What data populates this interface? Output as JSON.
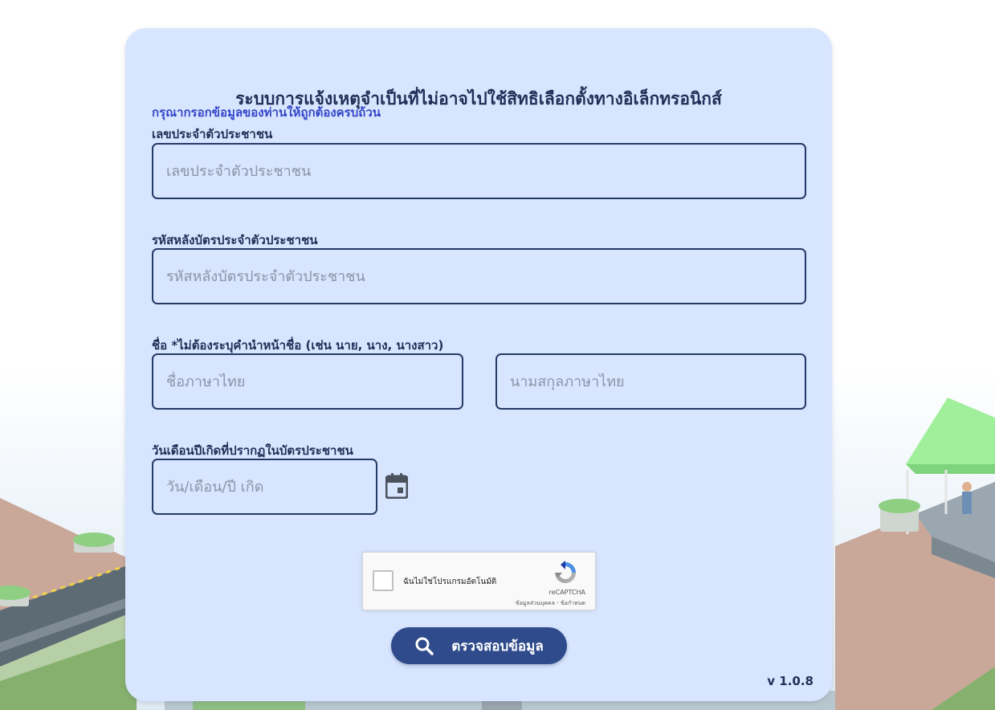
{
  "form": {
    "title": "ระบบการแจ้งเหตุจำเป็นที่ไม่อาจไปใช้สิทธิเลือกตั้งทางอิเล็กทรอนิกส์",
    "hint": "กรุณากรอกข้อมูลของท่านให้ถูกต้องครบถ้วน",
    "citizen_id": {
      "label": "เลขประจำตัวประชาชน",
      "placeholder": "เลขประจำตัวประชาชน",
      "value": ""
    },
    "laser_code": {
      "label": "รหัสหลังบัตรประจำตัวประชาชน",
      "placeholder": "รหัสหลังบัตรประจำตัวประชาชน",
      "value": ""
    },
    "name": {
      "label": "ชื่อ *ไม่ต้องระบุคำนำหน้าชื่อ (เช่น นาย, นาง, นางสาว)",
      "first_name_placeholder": "ชื่อภาษาไทย",
      "last_name_placeholder": "นามสกุลภาษาไทย"
    },
    "birth_date": {
      "label": "วันเดือนปีเกิดที่ปรากฏในบัตรประชาชน",
      "placeholder": "วัน/เดือน/ปี เกิด",
      "calendar_icon": "calendar-icon"
    },
    "recaptcha": {
      "checkbox_label": "ฉันไม่ใช่โปรแกรมอัตโนมัติ",
      "brand": "reCAPTCHA",
      "privacy_link": "ข้อมูลส่วนบุคคล",
      "separator": " - ",
      "terms_link": "ข้อกำหนด",
      "checked": false
    },
    "submit": {
      "label": "ตรวจสอบข้อมูล",
      "icon": "search-icon"
    },
    "version": "v 1.0.8"
  },
  "colors": {
    "card_background": "#d8e5fe",
    "title_text": "#1f2f57",
    "hint_text": "#3346c9",
    "field_border": "#243a66",
    "button_background": "#2f4b8c"
  }
}
